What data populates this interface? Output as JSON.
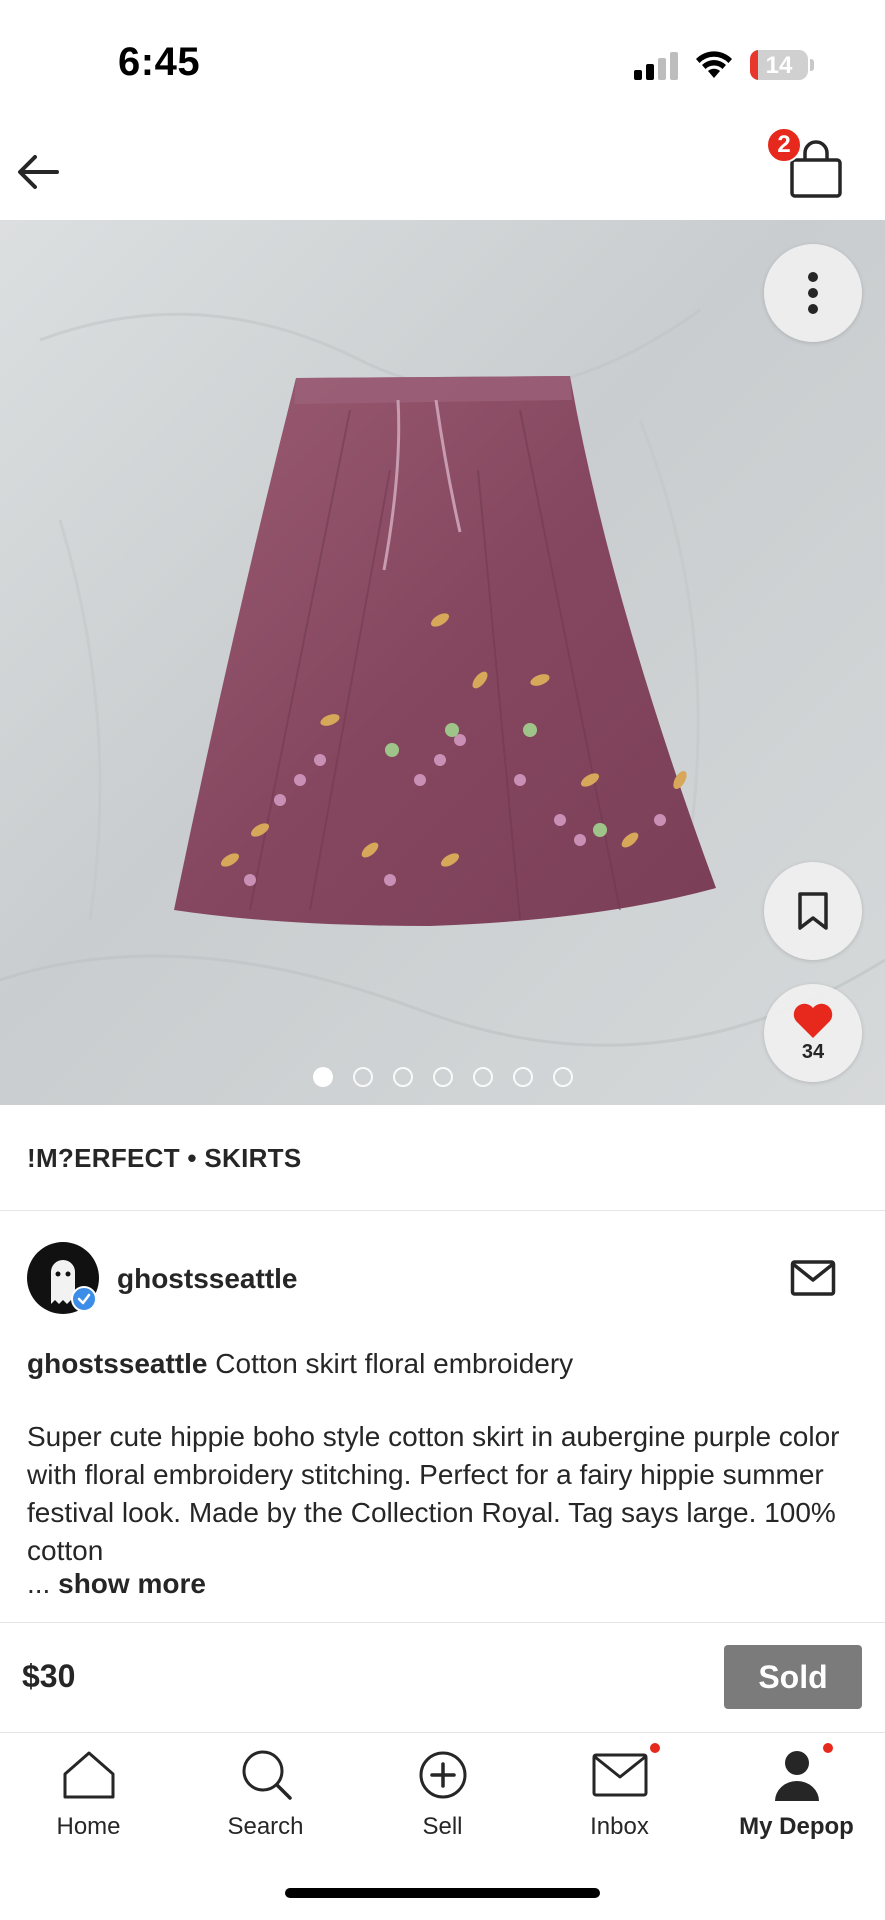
{
  "status_bar": {
    "time": "6:45",
    "battery": "14",
    "battery_level_percent": 14
  },
  "nav": {
    "back_icon": "arrow-left-icon",
    "bag_icon": "shopping-bag-icon",
    "bag_count": "2"
  },
  "product_image": {
    "more_icon": "more-vertical-icon",
    "save_icon": "bookmark-icon",
    "like_icon": "heart-icon",
    "like_count": "34",
    "image_count": 7,
    "active_image_index": 0
  },
  "listing": {
    "brand_category": "!M?ERFECT • SKIRTS",
    "seller": {
      "username": "ghostsseattle",
      "verified": true,
      "message_icon": "envelope-icon"
    },
    "title_user": "ghostsseattle",
    "title_text": " Cotton skirt floral embroidery",
    "description": "Super cute hippie boho style cotton skirt in aubergine purple color with floral embroidery stitching. Perfect for a fairy hippie summer festival look. Made by the Collection Royal. Tag says large. 100% cotton",
    "show_more_prefix": "... ",
    "show_more_label": "show more",
    "price": "$30",
    "sold_label": "Sold"
  },
  "tab_bar": {
    "items": [
      {
        "label": "Home",
        "icon": "home-icon"
      },
      {
        "label": "Search",
        "icon": "search-icon"
      },
      {
        "label": "Sell",
        "icon": "plus-circle-icon"
      },
      {
        "label": "Inbox",
        "icon": "envelope-icon"
      },
      {
        "label": "My Depop",
        "icon": "user-icon"
      }
    ],
    "active": "My Depop"
  },
  "colors": {
    "accent_red": "#e6291c",
    "sold_gray": "#7b7b7b",
    "skirt_purple": "#8a4a63",
    "verified_blue": "#3b8de8"
  }
}
